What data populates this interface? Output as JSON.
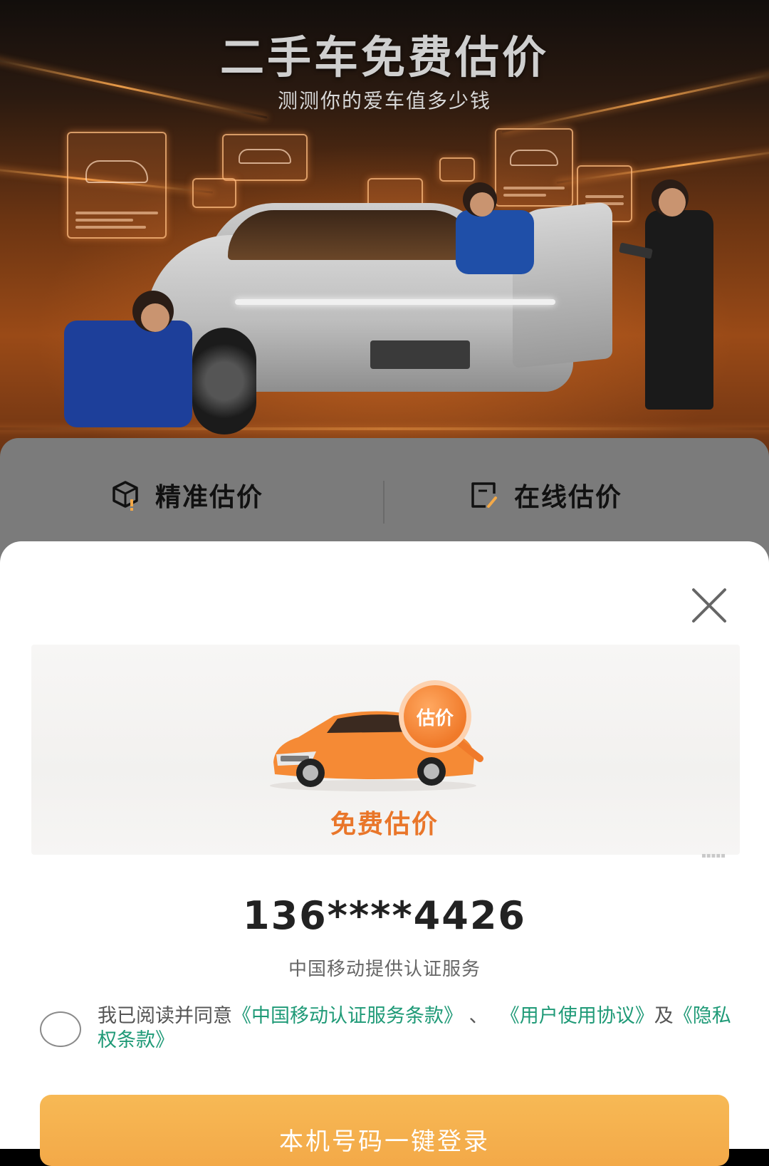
{
  "hero": {
    "title": "二手车免费估价",
    "subtitle": "测测你的爱车值多少钱"
  },
  "tabs": [
    {
      "label": "精准估价",
      "icon": "cube-warning-icon"
    },
    {
      "label": "在线估价",
      "icon": "document-edit-icon"
    }
  ],
  "sheet": {
    "close_icon": "close-icon",
    "banner": {
      "badge_text": "估价",
      "label": "免费估价"
    },
    "phone_number": "136****4426",
    "carrier_note": "中国移动提供认证服务",
    "agreement": {
      "prefix": "我已阅读并同意",
      "link1": "《中国移动认证服务条款》",
      "separator": "、",
      "link2": "《用户使用协议》",
      "and": "及",
      "link3": "《隐私权条款》"
    },
    "login_button": "本机号码一键登录"
  },
  "colors": {
    "accent_orange": "#f3a948",
    "link_green": "#1f9a77",
    "banner_label": "#e9762a"
  }
}
